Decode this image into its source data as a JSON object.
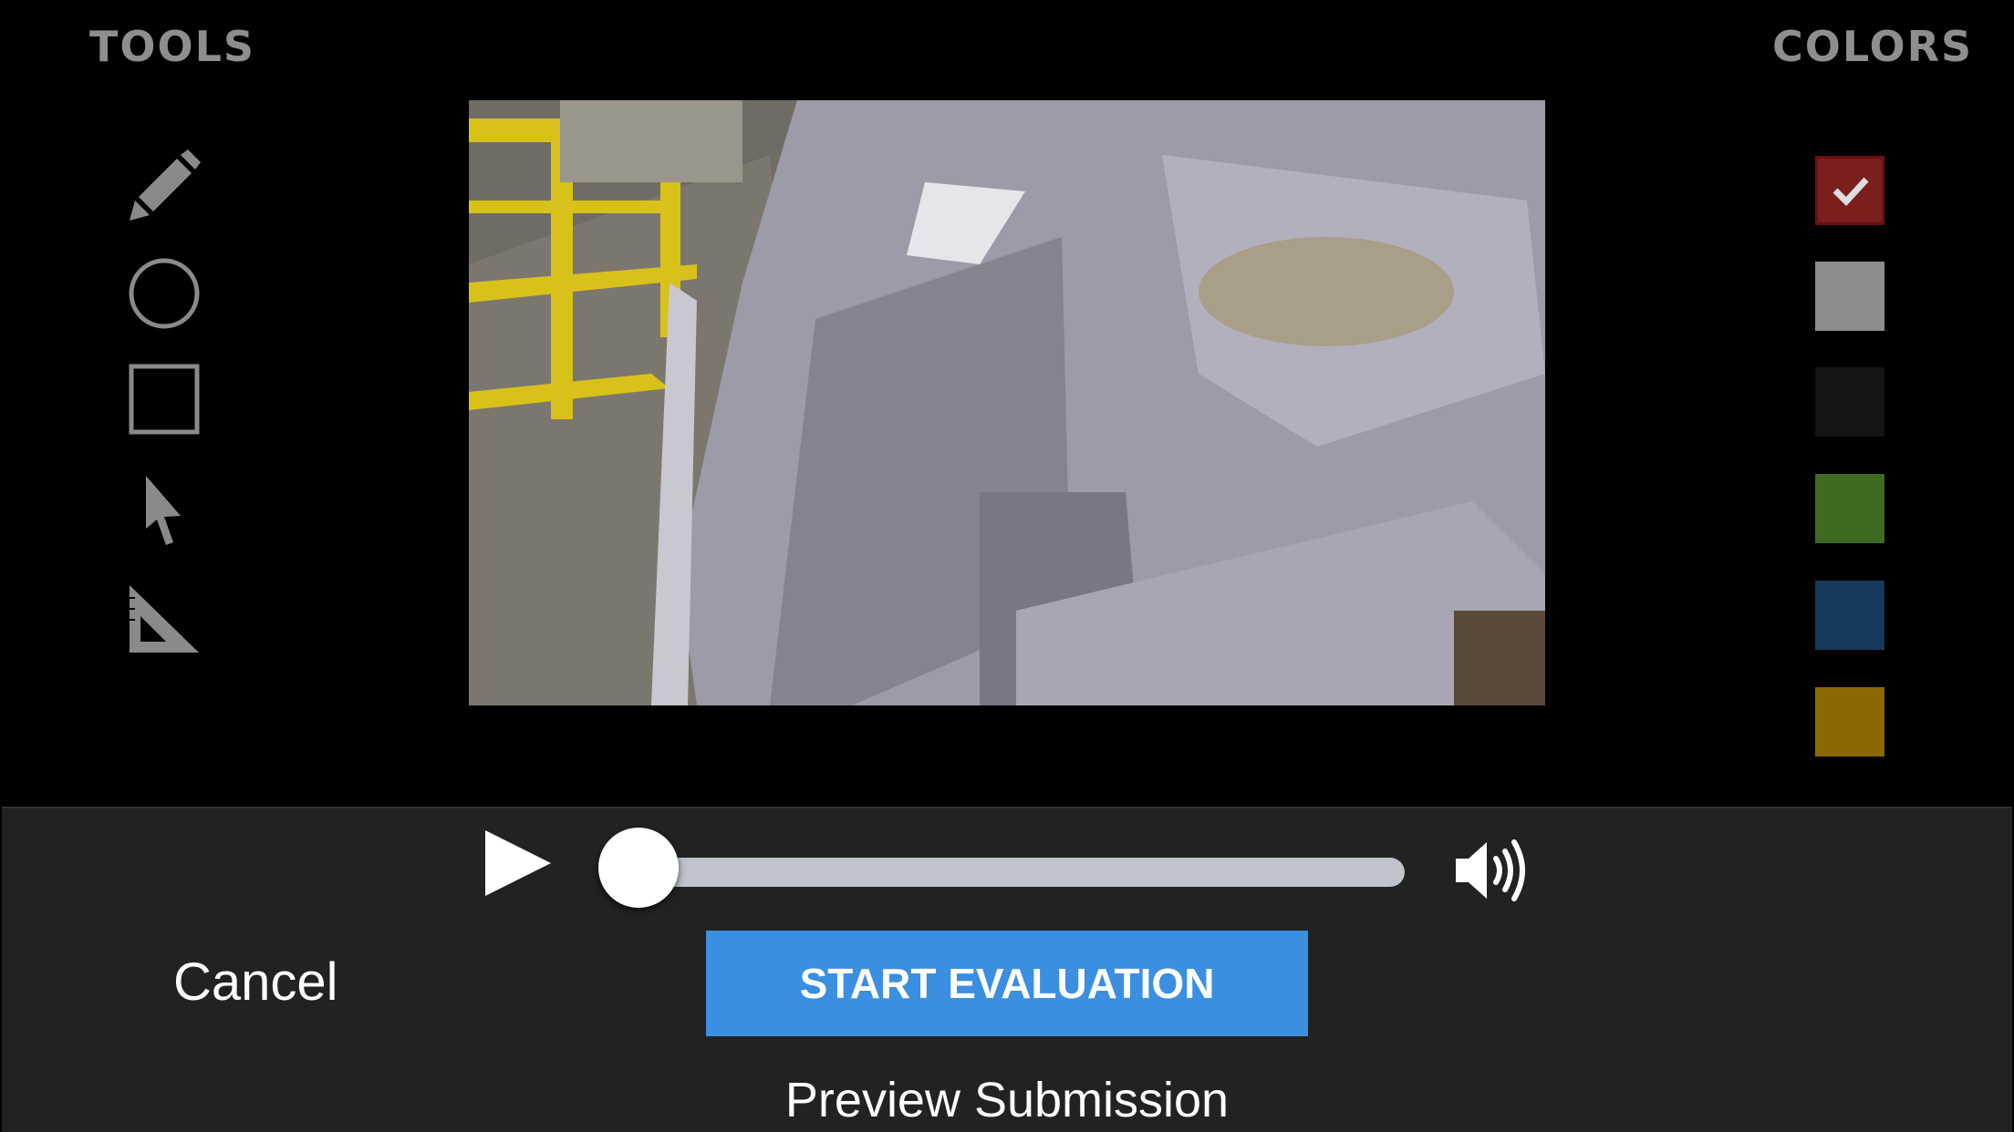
{
  "tools": {
    "heading": "TOOLS",
    "items": [
      {
        "name": "pencil",
        "icon": "pencil-icon"
      },
      {
        "name": "circle",
        "icon": "circle-icon"
      },
      {
        "name": "rectangle",
        "icon": "square-icon"
      },
      {
        "name": "pointer",
        "icon": "arrow-pointer-icon"
      },
      {
        "name": "angle",
        "icon": "set-square-icon"
      }
    ],
    "icon_color": "#8a8a8a"
  },
  "colors": {
    "heading": "COLORS",
    "swatches": [
      "#7a1e1e",
      "#8c8c8c",
      "#141414",
      "#3e6b20",
      "#143a5c",
      "#8a6a00"
    ],
    "selected_index": 0,
    "check_icon": "checkmark-icon"
  },
  "video": {
    "description_icon": "video-frame"
  },
  "player": {
    "play_icon": "play-icon",
    "volume_icon": "volume-icon",
    "progress": 0.0
  },
  "actions": {
    "cancel_label": "Cancel",
    "start_label": "START EVALUATION",
    "preview_label": "Preview Submission",
    "accent": "#3a8fe0"
  }
}
